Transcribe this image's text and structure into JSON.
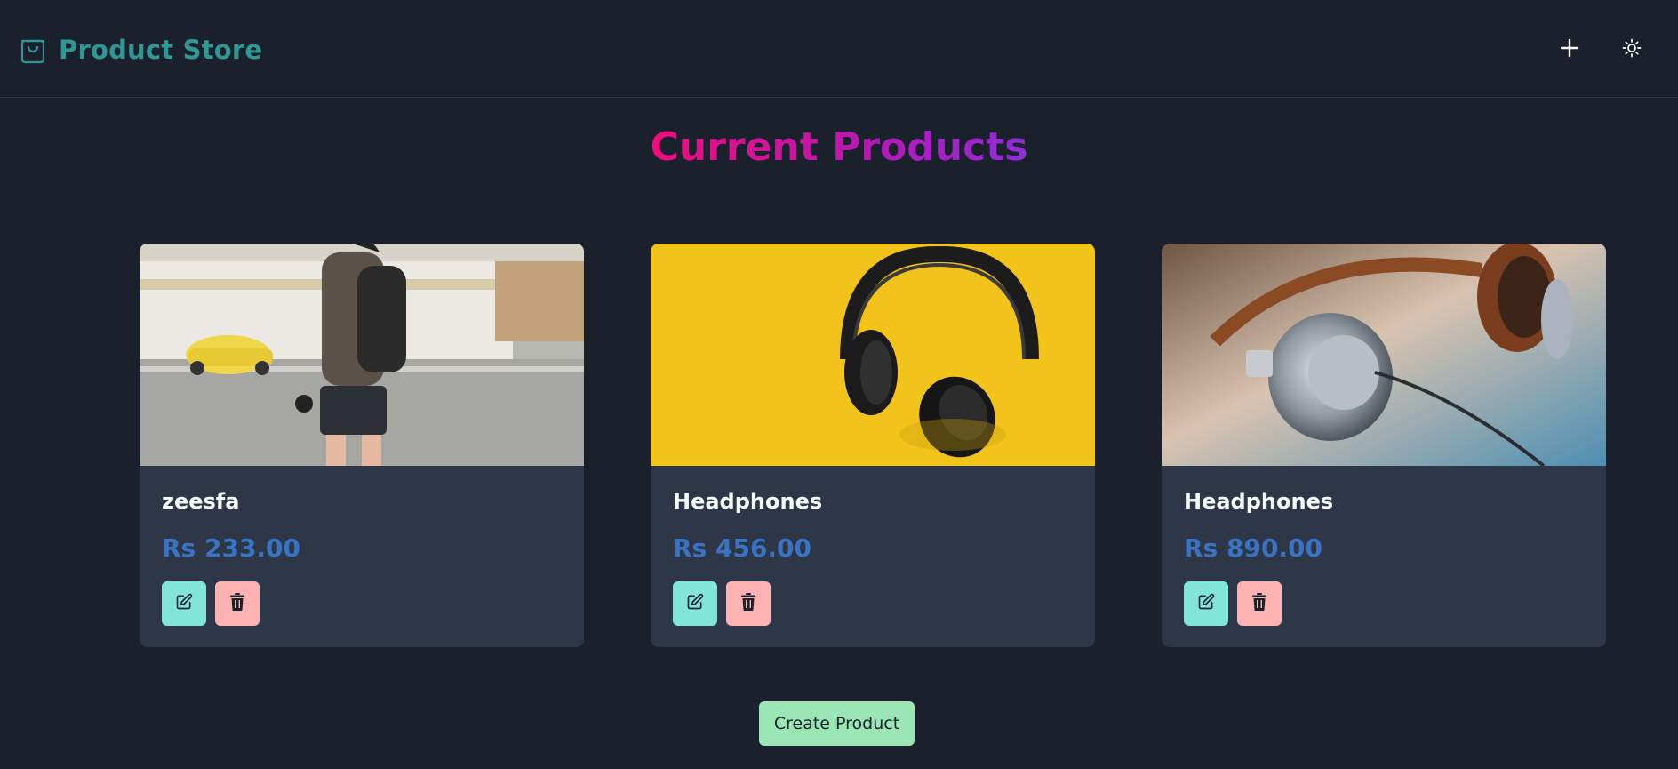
{
  "navbar": {
    "brand_icon": "shopping-bag-icon",
    "brand_title": "Product Store",
    "add_icon": "plus-icon",
    "theme_icon": "sun-icon",
    "brand_color": "#319795"
  },
  "main": {
    "title": "Current Products",
    "title_gradient": [
      "#ed0f7b",
      "#b21ab5",
      "#8e2fd6"
    ]
  },
  "products": [
    {
      "name": "zeesfa",
      "price": "Rs 233.00",
      "image": "person-with-backpack-street-photo",
      "edit_icon": "edit-icon",
      "delete_icon": "trash-icon"
    },
    {
      "name": "Headphones",
      "price": "Rs 456.00",
      "image": "black-headphones-on-yellow-photo",
      "edit_icon": "edit-icon",
      "delete_icon": "trash-icon"
    },
    {
      "name": "Headphones",
      "price": "Rs 890.00",
      "image": "silver-headphones-closeup-photo",
      "edit_icon": "edit-icon",
      "delete_icon": "trash-icon"
    }
  ],
  "footer": {
    "create_label": "Create Product"
  },
  "colors": {
    "background": "#1a202c",
    "card": "#2d3748",
    "price": "#3b73c4",
    "edit_button": "#81e6d9",
    "delete_button": "#feb2b2",
    "create_button": "#9ae6b4"
  }
}
